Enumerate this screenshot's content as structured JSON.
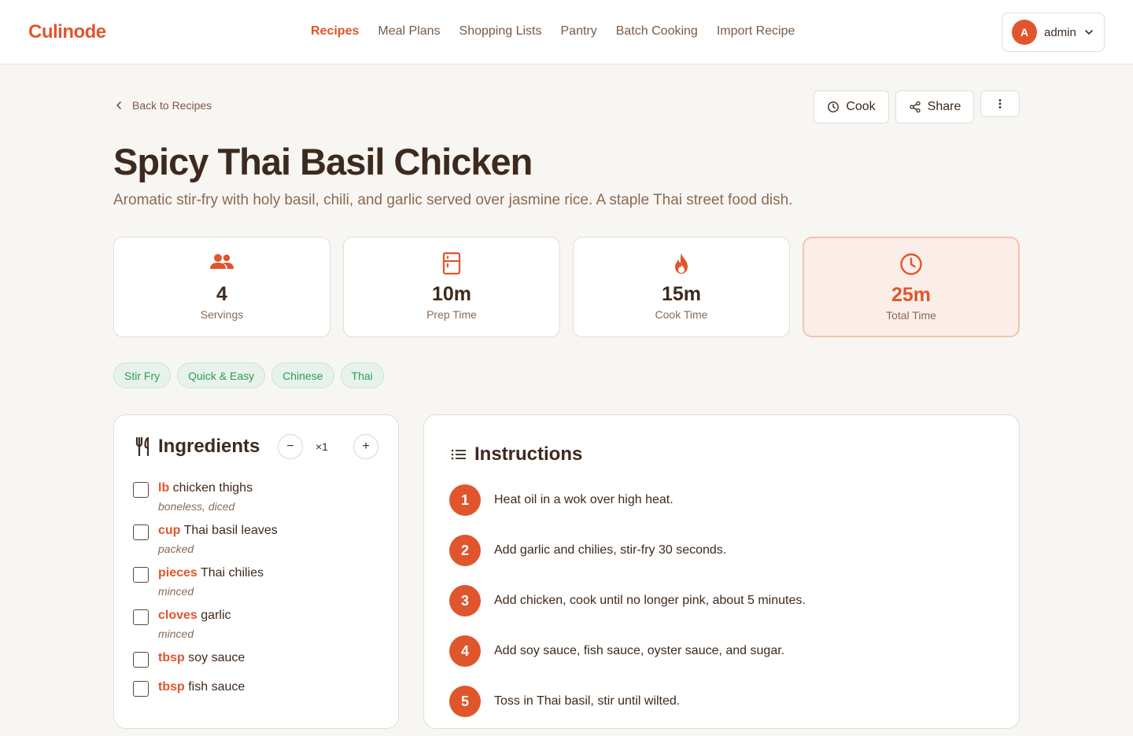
{
  "app": {
    "logo": "Culinode"
  },
  "nav": {
    "items": [
      "Recipes",
      "Meal Plans",
      "Shopping Lists",
      "Pantry",
      "Batch Cooking",
      "Import Recipe"
    ],
    "active": "Recipes"
  },
  "user": {
    "initial": "A",
    "name": "admin"
  },
  "page": {
    "back_label": "Back to Recipes",
    "cook_label": "Cook",
    "share_label": "Share",
    "title": "Spicy Thai Basil Chicken",
    "description": "Aromatic stir-fry with holy basil, chili, and garlic served over jasmine rice. A staple Thai street food dish."
  },
  "stats": [
    {
      "icon": "people-icon",
      "value": "4",
      "label": "Servings"
    },
    {
      "icon": "fridge-icon",
      "value": "10m",
      "label": "Prep Time"
    },
    {
      "icon": "flame-icon",
      "value": "15m",
      "label": "Cook Time"
    },
    {
      "icon": "clock-icon",
      "value": "25m",
      "label": "Total Time"
    }
  ],
  "tags": [
    "Stir Fry",
    "Quick & Easy",
    "Chinese",
    "Thai"
  ],
  "ingredients": {
    "title": "Ingredients",
    "minus": "−",
    "scale": "×1",
    "plus": "+",
    "items": [
      {
        "unit": "lb",
        "name": "chicken thighs",
        "note": "boneless, diced"
      },
      {
        "unit": "cup",
        "name": "Thai basil leaves",
        "note": "packed"
      },
      {
        "unit": "pieces",
        "name": "Thai chilies",
        "note": "minced"
      },
      {
        "unit": "cloves",
        "name": "garlic",
        "note": "minced"
      },
      {
        "unit": "tbsp",
        "name": "soy sauce",
        "note": ""
      },
      {
        "unit": "tbsp",
        "name": "fish sauce",
        "note": ""
      }
    ]
  },
  "instructions": {
    "title": "Instructions",
    "steps": [
      {
        "n": "1",
        "text": "Heat oil in a wok over high heat."
      },
      {
        "n": "2",
        "text": "Add garlic and chilies, stir-fry 30 seconds."
      },
      {
        "n": "3",
        "text": "Add chicken, cook until no longer pink, about 5 minutes."
      },
      {
        "n": "4",
        "text": "Add soy sauce, fish sauce, oyster sauce, and sugar."
      },
      {
        "n": "5",
        "text": "Toss in Thai basil, stir until wilted."
      }
    ]
  },
  "colors": {
    "accent": "#e0562c",
    "text": "#3d2a1e",
    "muted": "#8a6a52",
    "tag_bg": "#e7f3ea",
    "tag_text": "#2f9a5a",
    "page_bg": "#f8f6f3"
  }
}
